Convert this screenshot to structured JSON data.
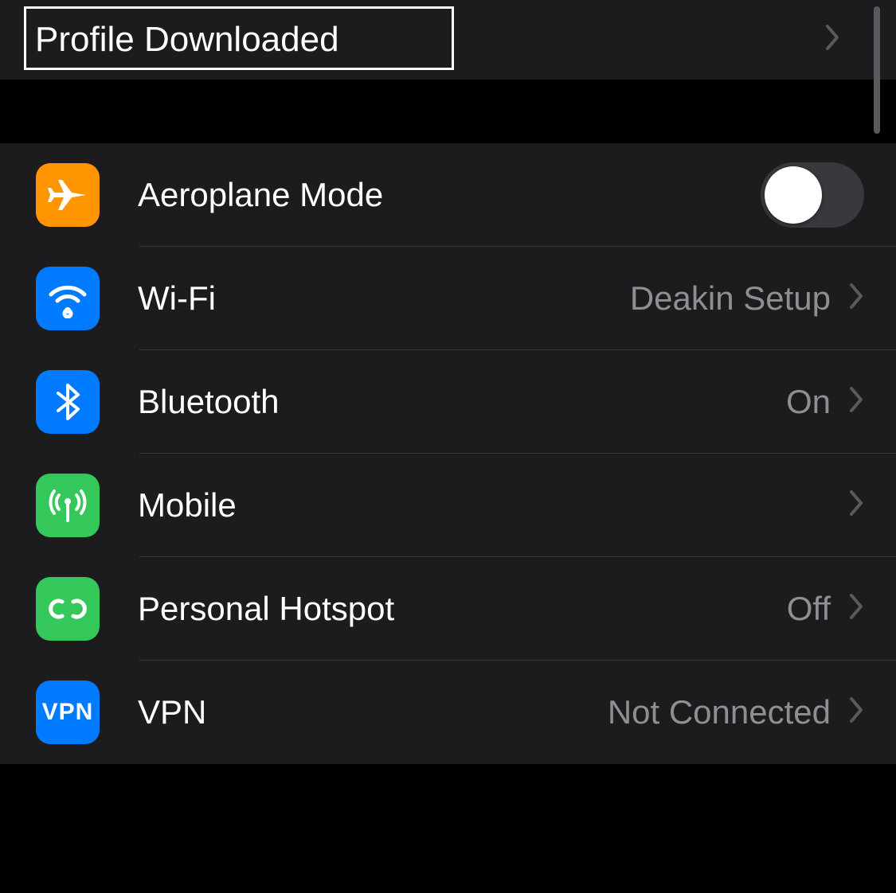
{
  "header": {
    "title": "Profile Downloaded"
  },
  "rows": {
    "aeroplane": {
      "label": "Aeroplane Mode",
      "toggle_on": false
    },
    "wifi": {
      "label": "Wi-Fi",
      "value": "Deakin Setup"
    },
    "bluetooth": {
      "label": "Bluetooth",
      "value": "On"
    },
    "mobile": {
      "label": "Mobile",
      "value": ""
    },
    "hotspot": {
      "label": "Personal Hotspot",
      "value": "Off"
    },
    "vpn": {
      "label": "VPN",
      "value": "Not Connected",
      "icon_text": "VPN"
    }
  },
  "colors": {
    "orange": "#ff9500",
    "blue": "#007aff",
    "green": "#34c759",
    "grey_text": "#8e8e93"
  }
}
